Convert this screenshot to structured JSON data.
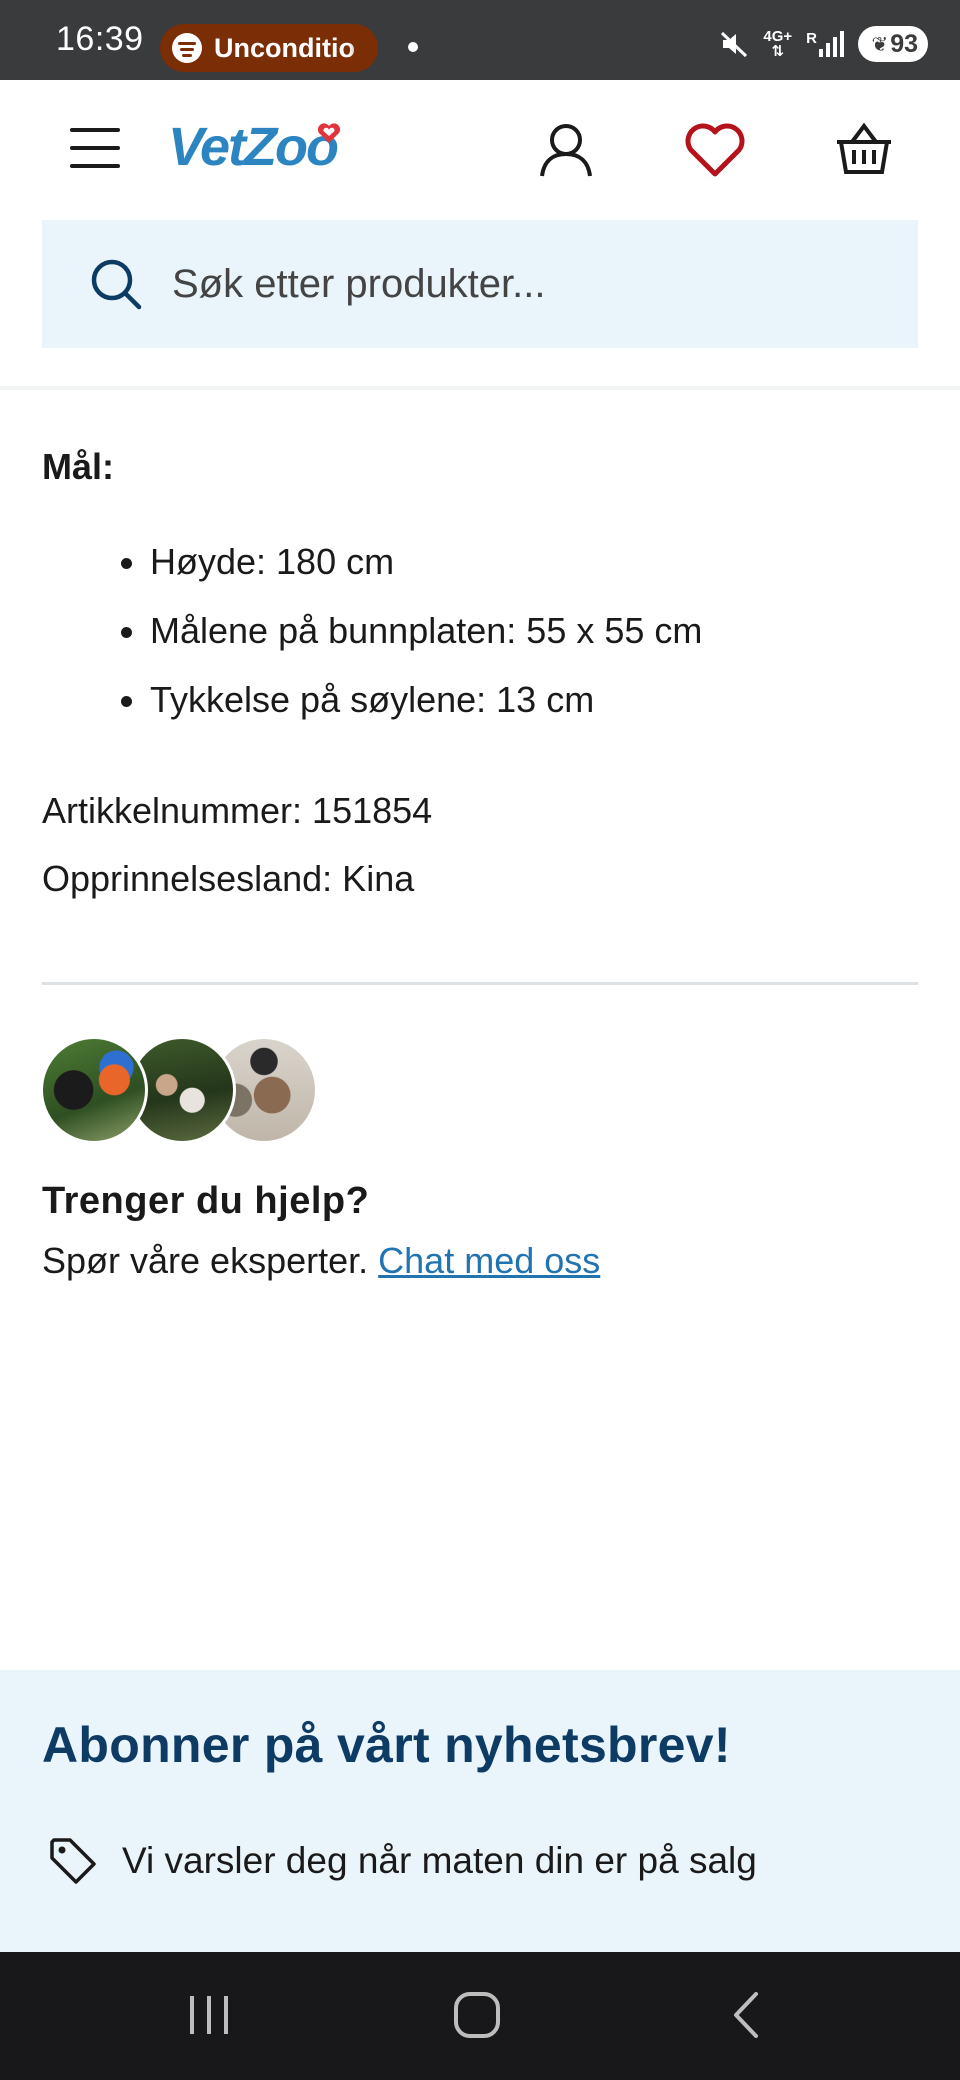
{
  "status_bar": {
    "time": "16:39",
    "media_label": "Unconditio",
    "network": "4G+",
    "roaming": "R",
    "battery": "93"
  },
  "header": {
    "logo": "VetZoo",
    "search_placeholder": "Søk etter produkter..."
  },
  "product_details": {
    "dimensions_heading": "Mål:",
    "dimensions": [
      "Høyde: 180 cm",
      "Målene på bunnplaten: 55 x 55 cm",
      "Tykkelse på søylene: 13 cm"
    ],
    "article_number": "Artikkelnummer: 151854",
    "origin_country": "Opprinnelsesland: Kina"
  },
  "help": {
    "title": "Trenger du hjelp?",
    "text": "Spør våre eksperter.",
    "link": "Chat med oss"
  },
  "newsletter": {
    "title": "Abonner på vårt nyhetsbrev!",
    "benefit": "Vi varsler deg når maten din er på salg"
  },
  "icons": {
    "menu": "hamburger-menu-icon",
    "account": "user-icon",
    "wishlist": "heart-icon",
    "cart": "basket-icon",
    "search": "search-icon",
    "tag": "tag-icon"
  },
  "colors": {
    "brand_blue": "#2c85c0",
    "wishlist_red": "#b5121b",
    "link_blue": "#2174b0",
    "newsletter_title": "#0d3b63",
    "search_bg": "#e9f4fb"
  }
}
